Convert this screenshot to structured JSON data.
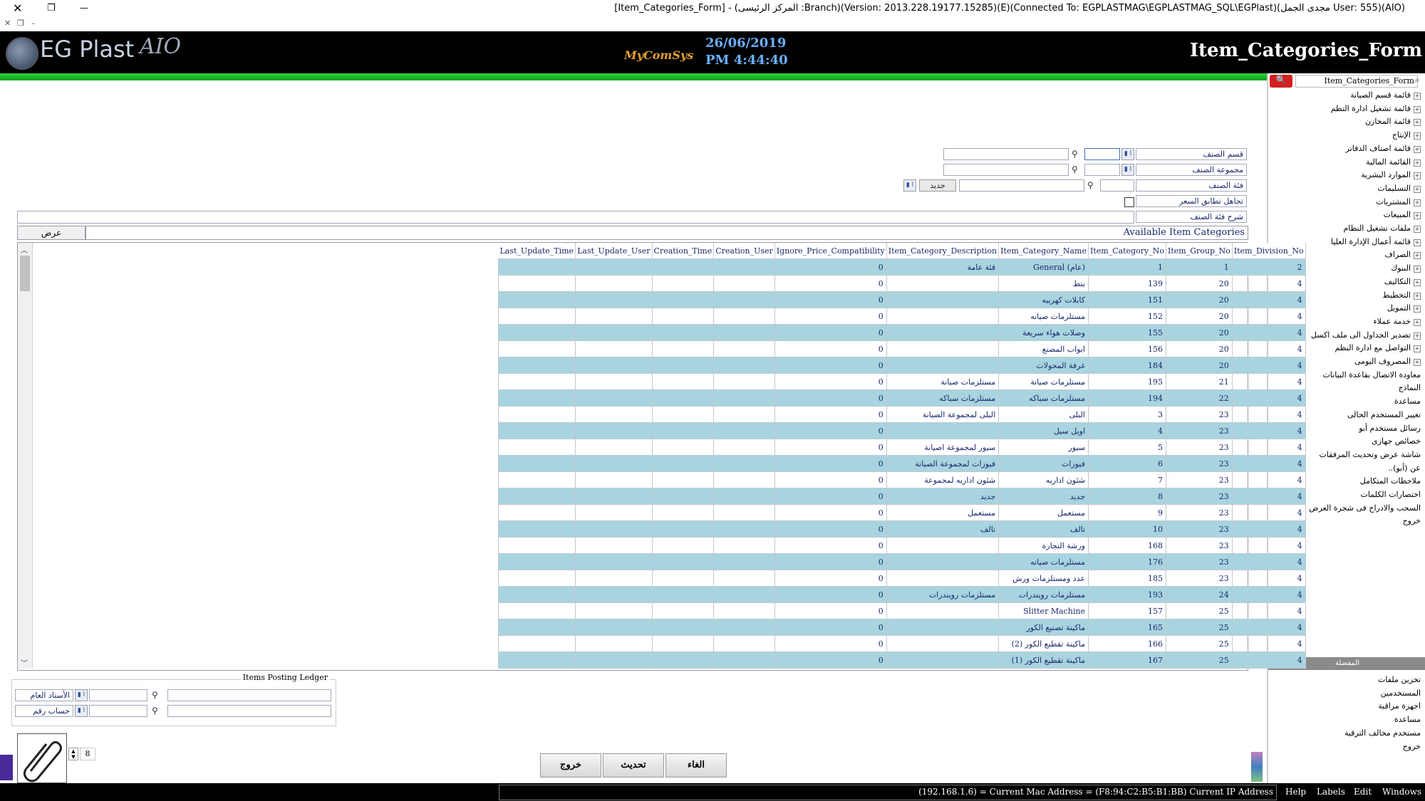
{
  "window": {
    "title": "[Item_Categories_Form] - (المركز الرئيسى :Branch)(Version: 2013.228.19177.15285)(E)(Connected To: EGPLASTMAG\\EGPLASTMAG_SQL\\EGPlast)(مجدى الجمل User: 555)(AIO)",
    "close_glyph": "✕",
    "restore_glyph": "❐",
    "minimize_glyph": "—"
  },
  "header": {
    "logo_text": "EG Plast",
    "logo_suffix": "AIO",
    "brand": "MyComSys",
    "date": "26/06/2019",
    "time": "PM 4:44:40",
    "form_title": "Item_Categories_Form"
  },
  "tree": {
    "search_value": "Item_Categories_Form",
    "items": [
      {
        "label": "قائمة قسم الصيانة",
        "expandable": true
      },
      {
        "label": "قائمة تشغيل ادارة النظم",
        "expandable": true
      },
      {
        "label": "قائمة المخازن",
        "expandable": true
      },
      {
        "label": "الإنتاج",
        "expandable": true
      },
      {
        "label": "قائمة اصناف الدفاتر",
        "expandable": true
      },
      {
        "label": "القائمة المالية",
        "expandable": true
      },
      {
        "label": "الموارد البشرية",
        "expandable": true
      },
      {
        "label": "التسليمات",
        "expandable": true
      },
      {
        "label": "المشتريات",
        "expandable": true
      },
      {
        "label": "المبيعات",
        "expandable": true
      },
      {
        "label": "ملفات تشغيل النظام",
        "expandable": true
      },
      {
        "label": "قائمة أعمال الإدارة العليا",
        "expandable": true
      },
      {
        "label": "الصراف",
        "expandable": true
      },
      {
        "label": "البنوك",
        "expandable": true
      },
      {
        "label": "التكاليف",
        "expandable": true
      },
      {
        "label": "التخطيط",
        "expandable": true
      },
      {
        "label": "التمويل",
        "expandable": true
      },
      {
        "label": "خدمة عملاء",
        "expandable": true
      },
      {
        "label": "تصدير الجداول الى ملف اكسل",
        "expandable": true
      },
      {
        "label": "التواصل مع ادارة النظم",
        "expandable": true
      },
      {
        "label": "المصروف اليومى",
        "expandable": true
      },
      {
        "label": "معاودة الاتصال بقاعدة البيانات",
        "expandable": false
      },
      {
        "label": "النماذج",
        "expandable": false
      },
      {
        "label": "مساعدة",
        "expandable": false
      },
      {
        "label": "تغيير المستخدم الحالى",
        "expandable": false
      },
      {
        "label": "رسائل مستخدم أبو",
        "expandable": false
      },
      {
        "label": "خصائص جهازى",
        "expandable": false
      },
      {
        "label": "شاشة عرض وتحديث المرفقات",
        "expandable": false
      },
      {
        "label": "عن (أبو)..",
        "expandable": false
      },
      {
        "label": "ملاحظات المتكامل",
        "expandable": false
      },
      {
        "label": "اختصارات الكلمات",
        "expandable": false
      },
      {
        "label": "السحب والادراج فى شجرة العرض",
        "expandable": false
      },
      {
        "label": "خروج",
        "expandable": false
      }
    ],
    "section_title": "المفضلة",
    "favorites": [
      "تخزين ملفات",
      "المستخدمين",
      "اجهزة مراقبة",
      "مساعدة",
      "مستخدم مخالف الترقية",
      "خروج"
    ]
  },
  "form": {
    "division_label": "قسم الصنف",
    "group_label": "مجموعة الصنف",
    "category_label": "فئة الصنف",
    "new_button": "جديد",
    "ignore_price_label": "تجاهل تطابق السعر",
    "category_desc_label": "شرح فئة الصنف",
    "tag_glyph": "▮ ا"
  },
  "grid": {
    "available_title": "Available Item Categories",
    "show_button": "عرض",
    "columns": [
      "Last_Update_Time",
      "Last_Update_User",
      "Creation_Time",
      "Creation_User",
      "Ignore_Price_Compatibility",
      "Item_Category_Description",
      "Item_Category_Name",
      "Item_Category_No",
      "Item_Group_No",
      "Item_Division_No"
    ],
    "rows": [
      {
        "compat": "0",
        "desc": "فئة عامة",
        "name": "General (عام)",
        "no": "1",
        "group": "1",
        "div": "2"
      },
      {
        "compat": "0",
        "desc": "",
        "name": "بنط",
        "no": "139",
        "group": "20",
        "div": "4"
      },
      {
        "compat": "0",
        "desc": "",
        "name": "كابلات كهربيه",
        "no": "151",
        "group": "20",
        "div": "4"
      },
      {
        "compat": "0",
        "desc": "",
        "name": "مستلزمات صيانه",
        "no": "152",
        "group": "20",
        "div": "4"
      },
      {
        "compat": "0",
        "desc": "",
        "name": "وصلات هواء سريعة",
        "no": "155",
        "group": "20",
        "div": "4"
      },
      {
        "compat": "0",
        "desc": "",
        "name": "ابواب المصنع",
        "no": "156",
        "group": "20",
        "div": "4"
      },
      {
        "compat": "0",
        "desc": "",
        "name": "غرفة المحولات",
        "no": "184",
        "group": "20",
        "div": "4"
      },
      {
        "compat": "0",
        "desc": "مستلزمات صيانة",
        "name": "مستلزمات صيانة",
        "no": "195",
        "group": "21",
        "div": "4"
      },
      {
        "compat": "0",
        "desc": "مستلزمات سباكه",
        "name": "مستلزمات سباكه",
        "no": "194",
        "group": "22",
        "div": "4"
      },
      {
        "compat": "0",
        "desc": "البلى لمجموعة الصيانة",
        "name": "البلى",
        "no": "3",
        "group": "23",
        "div": "4"
      },
      {
        "compat": "0",
        "desc": "",
        "name": "اويل سيل",
        "no": "4",
        "group": "23",
        "div": "4"
      },
      {
        "compat": "0",
        "desc": "سيور لمجموعة اصيانة",
        "name": "سيور",
        "no": "5",
        "group": "23",
        "div": "4"
      },
      {
        "compat": "0",
        "desc": "فيوزات لمجموعة الصيانة",
        "name": "فيوزات",
        "no": "6",
        "group": "23",
        "div": "4"
      },
      {
        "compat": "0",
        "desc": "شئون اداريه لمجموعة",
        "name": "شئون اداريه",
        "no": "7",
        "group": "23",
        "div": "4"
      },
      {
        "compat": "0",
        "desc": "جديد",
        "name": "جديد",
        "no": "8",
        "group": "23",
        "div": "4"
      },
      {
        "compat": "0",
        "desc": "مستعمل",
        "name": "مستعمل",
        "no": "9",
        "group": "23",
        "div": "4"
      },
      {
        "compat": "0",
        "desc": "تالف",
        "name": "تالف",
        "no": "10",
        "group": "23",
        "div": "4"
      },
      {
        "compat": "0",
        "desc": "",
        "name": "ورشة النجارة",
        "no": "168",
        "group": "23",
        "div": "4"
      },
      {
        "compat": "0",
        "desc": "",
        "name": "مستلزمات صيانه",
        "no": "176",
        "group": "23",
        "div": "4"
      },
      {
        "compat": "0",
        "desc": "",
        "name": "عدد ومستلزمات ورش",
        "no": "185",
        "group": "23",
        "div": "4"
      },
      {
        "compat": "0",
        "desc": "مستلزمات رويندرات",
        "name": "مستلزمات رويندرات",
        "no": "193",
        "group": "24",
        "div": "4"
      },
      {
        "compat": "0",
        "desc": "",
        "name": "Slitter Machine",
        "no": "157",
        "group": "25",
        "div": "4"
      },
      {
        "compat": "0",
        "desc": "",
        "name": "ماكينة تصنيع الكور",
        "no": "165",
        "group": "25",
        "div": "4"
      },
      {
        "compat": "0",
        "desc": "",
        "name": "ماكينة تقطيع الكور (2)",
        "no": "166",
        "group": "25",
        "div": "4"
      },
      {
        "compat": "0",
        "desc": "",
        "name": "ماكينة تقطيع الكور (1)",
        "no": "167",
        "group": "25",
        "div": "4"
      }
    ]
  },
  "ledger": {
    "title": "Items Posting Ledger",
    "general_label": "الأستاذ العام",
    "account_label": "حساب رقم"
  },
  "footer": {
    "page_value": "8",
    "exit_button": "خروج",
    "refresh_button": "تحديث",
    "cancel_button": "الغاء"
  },
  "statusbar": {
    "text": "(192.168.1.6) = Current Mac Address = (F8:94:C2:B5:B1:BB) Current IP Address",
    "menus": [
      "Help",
      "Labels",
      "Edit",
      "Windows"
    ]
  }
}
